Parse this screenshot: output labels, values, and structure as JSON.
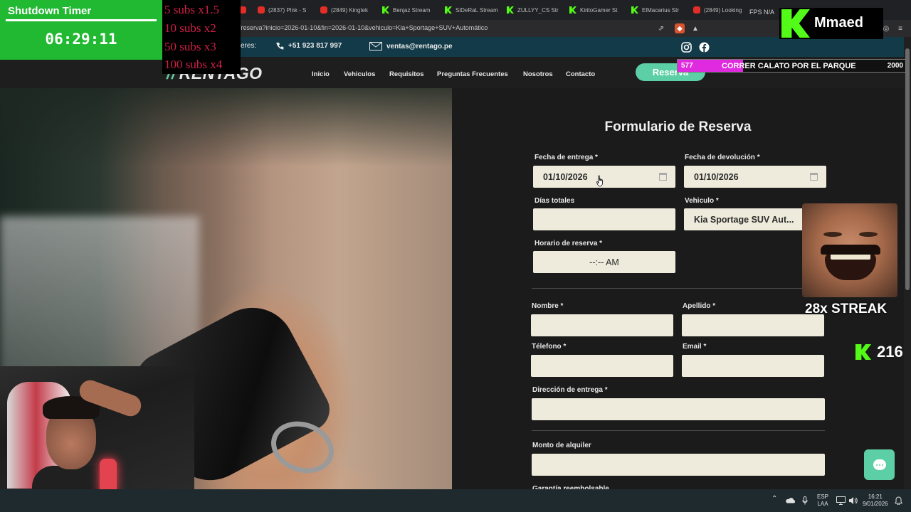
{
  "browser": {
    "tabs": [
      {
        "label": "",
        "icon": "youtube"
      },
      {
        "label": "(2837) Plnk - S",
        "icon": "youtube"
      },
      {
        "label": "(2849) Kingtek",
        "icon": "youtube"
      },
      {
        "label": "Benjaz Stream",
        "icon": "kick"
      },
      {
        "label": "SiDeRaL Stream",
        "icon": "kick"
      },
      {
        "label": "ZULLYY_CS Str",
        "icon": "kick"
      },
      {
        "label": "KiritoGamer St",
        "icon": "kick"
      },
      {
        "label": "ElMacarius Str",
        "icon": "kick"
      },
      {
        "label": "(2849) Looking",
        "icon": "youtube"
      }
    ],
    "url": "/reserva?inicio=2026-01-10&fin=2026-01-10&vehiculo=Kia+Sportage+SUV+Automático"
  },
  "site": {
    "topbar": {
      "contact_prefix": "eres:",
      "phone": "+51 923 817 997",
      "email": "ventas@rentago.pe"
    },
    "logo": "RENTAGO",
    "nav": [
      "Inicio",
      "Vehiculos",
      "Requisitos",
      "Preguntas Frecuentes",
      "Nosotros",
      "Contacto"
    ],
    "reserve_button": "Reserva"
  },
  "form": {
    "title": "Formulario de Reserva",
    "fecha_entrega": {
      "label": "Fecha de entrega *",
      "value": "01/10/2026"
    },
    "fecha_devolucion": {
      "label": "Fecha de devolución *",
      "value": "01/10/2026"
    },
    "dias_totales": {
      "label": "Días totales",
      "value": ""
    },
    "vehiculo": {
      "label": "Vehiculo *",
      "value": "Kia Sportage SUV Aut..."
    },
    "horario": {
      "label": "Horario de reserva *",
      "value": "--:-- AM"
    },
    "nombre": {
      "label": "Nombre *",
      "value": ""
    },
    "apellido": {
      "label": "Apellido *",
      "value": ""
    },
    "telefono": {
      "label": "Télefono *",
      "value": ""
    },
    "email": {
      "label": "Email *",
      "value": ""
    },
    "direccion": {
      "label": "Dirección de entrega *",
      "value": ""
    },
    "monto": {
      "label": "Monto de alquiler",
      "value": ""
    },
    "garantia_partial": {
      "label": "Garantía reembolsable"
    }
  },
  "overlay": {
    "timer_title": "Shutdown Timer",
    "timer_value": "06:29:11",
    "subs": [
      "5 subs x1.5",
      "10 subs x2",
      "50 subs x3",
      "100 subs x4"
    ],
    "kick_name": "Mmaed",
    "fps": "FPS N/A",
    "goal": {
      "current": "577",
      "name": "CORRER CALATO POR EL PARQUE",
      "target": "2000",
      "progress": 0.2885
    },
    "streak": "28x STREAK",
    "viewers": "216"
  },
  "taskbar": {
    "lang_top": "ESP",
    "lang_bottom": "LAA",
    "time": "16:21",
    "date": "9/01/2026"
  },
  "colors": {
    "accent": "#5dcfa7",
    "topbar": "#123a48",
    "field_bg": "#eeebdc",
    "kick_green": "#53fc18",
    "goal_fill": "#e02adf"
  }
}
